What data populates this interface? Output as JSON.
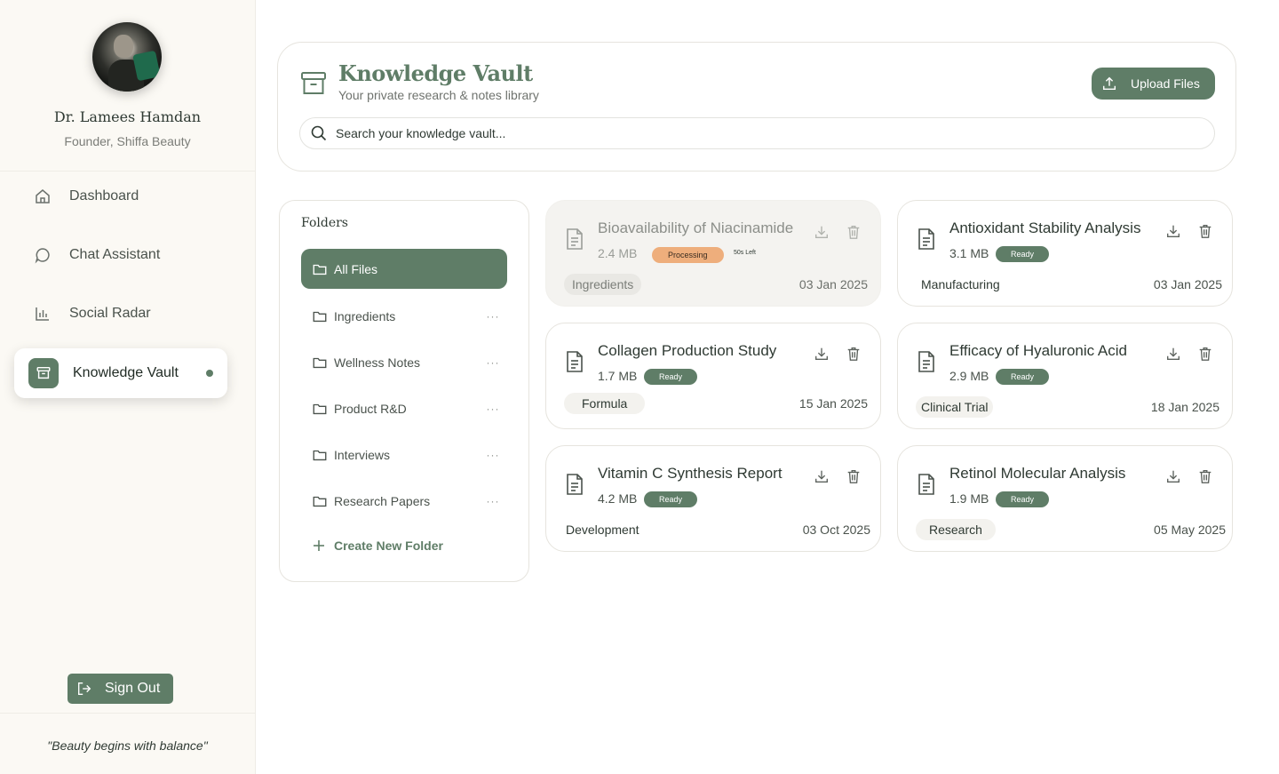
{
  "profile": {
    "name": "Dr. Lamees Hamdan",
    "role": "Founder, Shiffa Beauty"
  },
  "nav": {
    "items": [
      {
        "label": "Dashboard",
        "icon": "home-icon"
      },
      {
        "label": "Chat Assistant",
        "icon": "chat-icon"
      },
      {
        "label": "Social Radar",
        "icon": "bar-chart-icon"
      },
      {
        "label": "Knowledge Vault",
        "icon": "archive-icon",
        "active": true
      }
    ]
  },
  "signout_label": "Sign Out",
  "quote": "\"Beauty begins with balance\"",
  "header": {
    "title": "Knowledge Vault",
    "subtitle": "Your private research & notes library",
    "upload_label": "Upload Files",
    "search_placeholder": "Search your knowledge vault..."
  },
  "folders": {
    "title": "Folders",
    "all_label": "All Files",
    "items": [
      "Ingredients",
      "Wellness Notes",
      "Product R&D",
      "Interviews",
      "Research Papers"
    ],
    "create_label": "Create New Folder"
  },
  "files": [
    {
      "name": "Bioavailability of Niacinamide",
      "size": "2.4 MB",
      "status": "Processing",
      "time_left": "50s Left",
      "tag": "Ingredients",
      "date": "03 Jan 2025"
    },
    {
      "name": "Antioxidant Stability Analysis",
      "size": "3.1 MB",
      "status": "Ready",
      "tag": "Manufacturing",
      "date": "03 Jan 2025"
    },
    {
      "name": "Collagen Production Study",
      "size": "1.7 MB",
      "status": "Ready",
      "tag": "Formula",
      "date": "15 Jan 2025"
    },
    {
      "name": "Efficacy of Hyaluronic Acid",
      "size": "2.9 MB",
      "status": "Ready",
      "tag": "Clinical Trial",
      "date": "18 Jan 2025"
    },
    {
      "name": "Vitamin C Synthesis Report",
      "size": "4.2 MB",
      "status": "Ready",
      "tag": "Development",
      "date": "03 Oct 2025"
    },
    {
      "name": "Retinol Molecular Analysis",
      "size": "1.9 MB",
      "status": "Ready",
      "tag": "Research",
      "date": "05 May 2025"
    }
  ],
  "colors": {
    "accent": "#5f7d67",
    "processing": "#eeae7c",
    "sidebar_bg": "#fbf9f4"
  }
}
